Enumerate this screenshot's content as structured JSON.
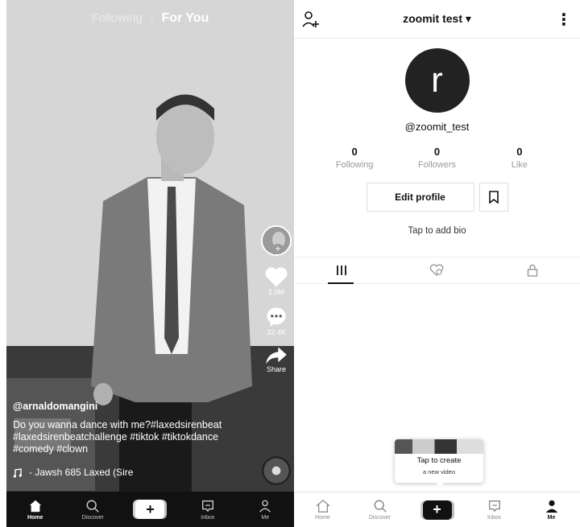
{
  "feed": {
    "tabs": {
      "following": "Following",
      "foryou": "For You"
    },
    "actions": {
      "likes": "2.0M",
      "comments": "32.4K",
      "share": "Share"
    },
    "caption": {
      "user": "@arnaldomangini",
      "text": "Do you wanna dance with me?#laxedsirenbeat #laxedsirenbeatchallenge  #tiktok #tiktokdance #comedy #clown",
      "music": "- Jawsh 685   Laxed (Sire"
    },
    "nav": {
      "home": "Home",
      "discover": "Discover",
      "plus": "+",
      "inbox": "Inbox",
      "me": "Me"
    }
  },
  "profile": {
    "header": {
      "title": "zoomit test ▾",
      "more": "⋮"
    },
    "avatar_letter": "r",
    "handle": "@zoomit_test",
    "stats": [
      {
        "num": "0",
        "label": "Following"
      },
      {
        "num": "0",
        "label": "Followers"
      },
      {
        "num": "0",
        "label": "Like"
      }
    ],
    "edit_profile": "Edit profile",
    "bio_prompt": "Tap to add bio",
    "tooltip": {
      "title": "Tap to create",
      "subtitle": "a new video"
    },
    "nav": {
      "home": "Home",
      "discover": "Discover",
      "plus": "+",
      "inbox": "Inbox",
      "me": "Me"
    }
  },
  "colors": {
    "accent": "#111111",
    "muted": "#999999"
  }
}
